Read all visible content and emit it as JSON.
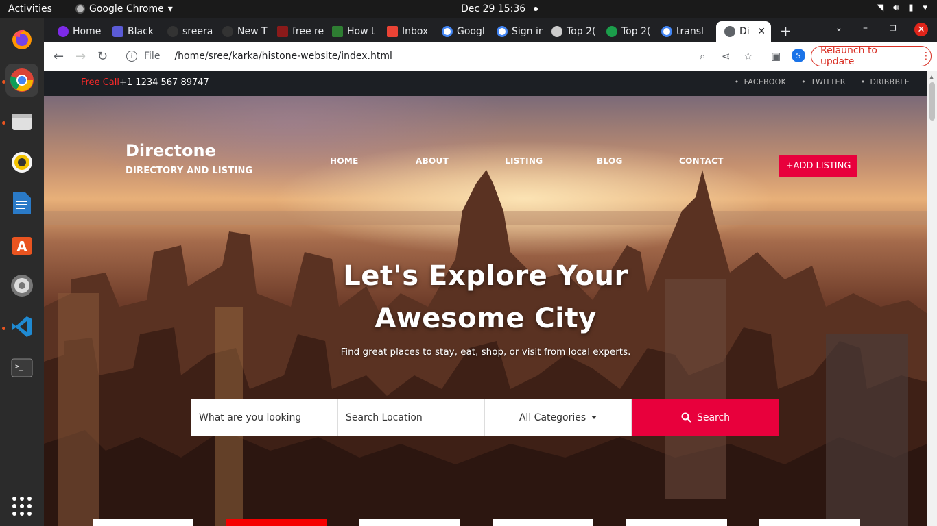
{
  "os": {
    "activities": "Activities",
    "app_name": "Google Chrome",
    "clock": "Dec 29  15:36"
  },
  "dock": {
    "apps": [
      "firefox",
      "chrome",
      "files",
      "rhythmbox",
      "libreoffice-writer",
      "software",
      "settings",
      "vscode",
      "terminal",
      "show-apps"
    ]
  },
  "browser": {
    "tabs": [
      {
        "label": "Home",
        "icon": "canva-icon"
      },
      {
        "label": "Black",
        "icon": "app-icon"
      },
      {
        "label": "sreera",
        "icon": "github-icon"
      },
      {
        "label": "New T",
        "icon": "github-icon"
      },
      {
        "label": "free re",
        "icon": "site-icon"
      },
      {
        "label": "How t",
        "icon": "faq-icon"
      },
      {
        "label": "Inbox",
        "icon": "gmail-icon"
      },
      {
        "label": "Googl",
        "icon": "google-icon"
      },
      {
        "label": "Sign in",
        "icon": "google-icon"
      },
      {
        "label": "Top 2(",
        "icon": "site-icon"
      },
      {
        "label": "Top 2(",
        "icon": "site-icon"
      },
      {
        "label": "transl",
        "icon": "google-icon"
      },
      {
        "label": "Di",
        "icon": "globe-icon"
      }
    ],
    "scheme": "File",
    "url": "/home/sree/karka/histone-website/index.html",
    "profile_initial": "S",
    "relaunch": "Relaunch to update",
    "accent": "#d93025"
  },
  "site": {
    "infobar": {
      "call_label": "Free Call",
      "phone": "+1 1234 567 89747",
      "social": [
        "FACEBOOK",
        "TWITTER",
        "DRIBBBLE"
      ]
    },
    "brand": {
      "name": "Directone",
      "tagline": "DIRECTORY AND LISTING"
    },
    "menu": [
      "HOME",
      "ABOUT",
      "LISTING",
      "BLOG",
      "CONTACT"
    ],
    "add_listing": "+ADD LISTING",
    "hero": {
      "line1": "Let's Explore Your",
      "line2": "Awesome City",
      "subtitle": "Find great places to stay, eat, shop, or visit from local experts."
    },
    "search": {
      "what_placeholder": "What are you looking",
      "where_placeholder": "Search Location",
      "category": "All Categories",
      "button": "Search"
    },
    "categories": [
      {
        "icon": "burger-icon",
        "active": false
      },
      {
        "icon": "building-icon",
        "active": true
      },
      {
        "icon": "cart-icon",
        "active": false
      },
      {
        "icon": "heart-eyes-icon",
        "active": false
      },
      {
        "icon": "dumbbell-icon",
        "active": false
      },
      {
        "icon": "drama-mask-icon",
        "active": false
      }
    ],
    "brand_color": "#e8003c"
  }
}
